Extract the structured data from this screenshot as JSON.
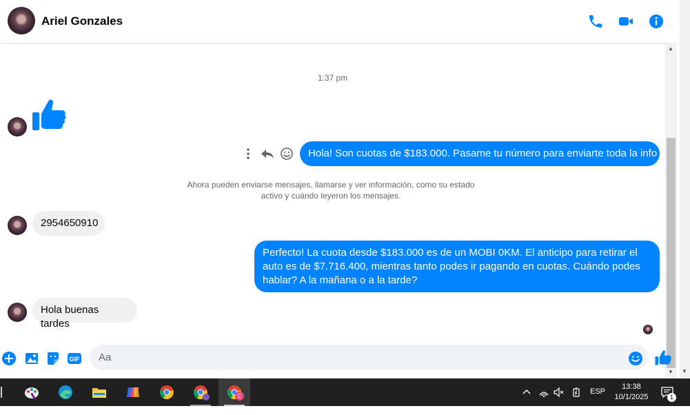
{
  "header": {
    "contact_name": "Ariel Gonzales"
  },
  "chat": {
    "timestamp": "1:37 pm",
    "messages": [
      {
        "from": "contact",
        "type": "like"
      },
      {
        "from": "me",
        "text": "Hola! Son cuotas de $183.000. Pasame tu número para enviarte toda la info"
      },
      {
        "from": "system",
        "text": "Ahora pueden enviarse mensajes, llamarse y ver información, como su estado activo y cuándo leyeron los mensajes."
      },
      {
        "from": "contact",
        "text": "2954650910"
      },
      {
        "from": "me",
        "text": "Perfecto! La cuota desde $183.000 es de un MOBI 0KM. El anticipo para retirar el auto es de $7.716.400, mientras tanto podes ir pagando en cuotas. Cuándo podes hablar? A la mañana o a la tarde?"
      },
      {
        "from": "contact",
        "text": "Hola buenas tardes"
      }
    ]
  },
  "composer": {
    "placeholder": "Aa"
  },
  "taskbar": {
    "language": "ESP",
    "time": "13:38",
    "date": "10/1/2025",
    "notification_count": "1",
    "badge_letter": "C"
  },
  "colors": {
    "accent": "#0084ff",
    "incoming_bubble": "#f0f0f0",
    "taskbar": "#202020"
  }
}
